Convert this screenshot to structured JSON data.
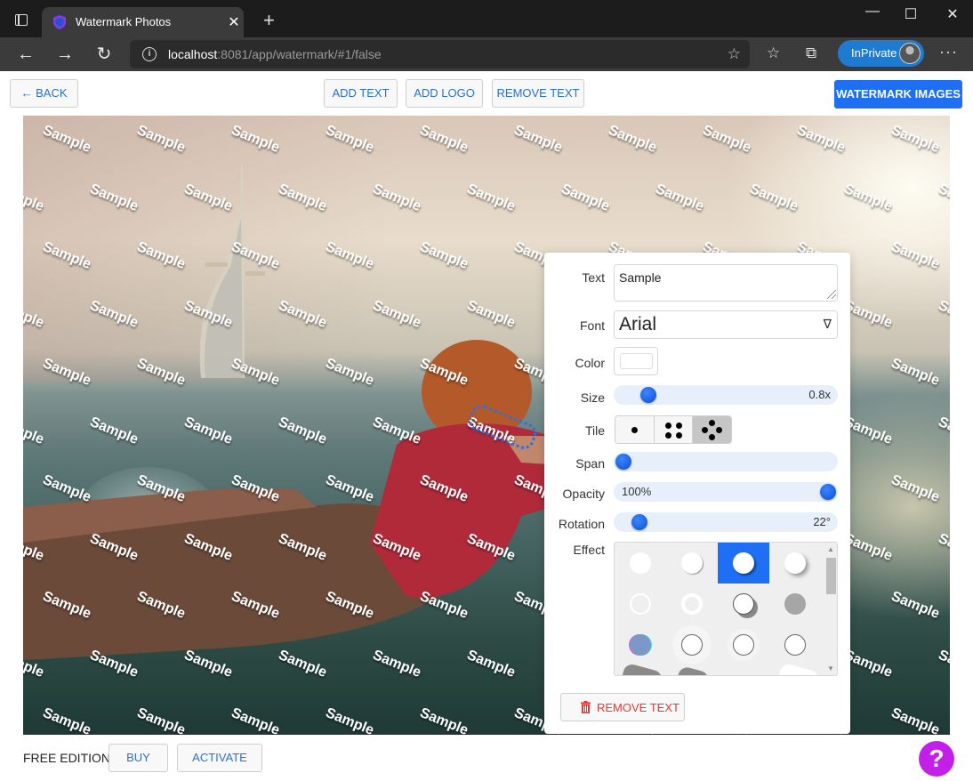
{
  "browser": {
    "tab_title": "Watermark Photos",
    "url_host": "localhost",
    "url_rest": ":8081/app/watermark/#1/false",
    "inprivate_label": "InPrivate",
    "new_tab_symbol": "+",
    "tab_close_symbol": "✕",
    "more_symbol": "···"
  },
  "header": {
    "back_label": "← BACK",
    "add_text_label": "ADD TEXT",
    "add_logo_label": "ADD LOGO",
    "remove_text_label": "REMOVE TEXT",
    "watermark_images_label": "WATERMARK IMAGES",
    "accent_color": "#1e6ff3"
  },
  "watermark": {
    "text": "Sample",
    "rotation_deg": 22,
    "color": "#ffffff"
  },
  "panel": {
    "text_label": "Text",
    "text_value": "Sample",
    "font_label": "Font",
    "font_value": "Arial",
    "font_caret": "∇",
    "color_label": "Color",
    "color_value": "#ffffff",
    "size_label": "Size",
    "size_value": "0.8x",
    "size_fraction": 0.12,
    "tile_label": "Tile",
    "tile_options": [
      "single",
      "grid",
      "staggered"
    ],
    "tile_selected": "staggered",
    "span_label": "Span",
    "span_fraction": 0.0,
    "opacity_label": "Opacity",
    "opacity_value": "100%",
    "opacity_fraction": 1.0,
    "rotation_label": "Rotation",
    "rotation_value": "22°",
    "rotation_fraction": 0.08,
    "effect_label": "Effect",
    "effect_selected_index": 2,
    "remove_text_label": "REMOVE TEXT",
    "remove_color": "#e53935"
  },
  "footer": {
    "edition_label": "FREE EDITION",
    "buy_label": "BUY",
    "activate_label": "ACTIVATE",
    "help_symbol": "?",
    "help_color": "#c21fe8"
  }
}
